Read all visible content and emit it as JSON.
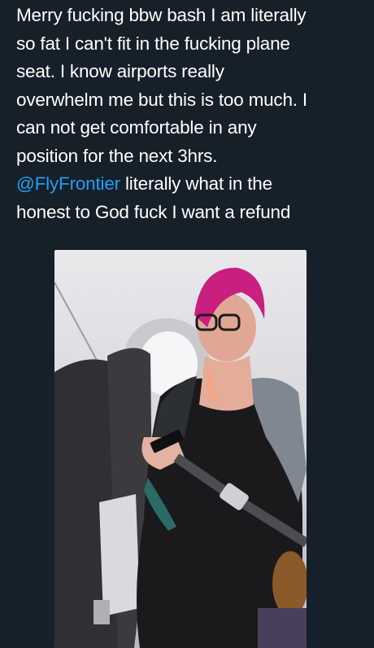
{
  "tweet": {
    "lines": [
      {
        "text": "Merry fucking bbw bash I am literally"
      },
      {
        "text": "so fat I can't fit in the fucking plane"
      },
      {
        "text": "seat. I know airports really"
      },
      {
        "text": "overwhelm me but this is too much. I"
      },
      {
        "text": "can not get comfortable in any"
      },
      {
        "text": "position for the next 3hrs."
      },
      {
        "mention": "@FlyFrontier",
        "rest": " literally what in the"
      },
      {
        "text": "honest to God fuck I want a refund"
      }
    ]
  },
  "colors": {
    "background": "#15202b",
    "text": "#ffffff",
    "mention": "#1da1f2"
  },
  "photo": {
    "icon": "airplane-seat-photo"
  }
}
